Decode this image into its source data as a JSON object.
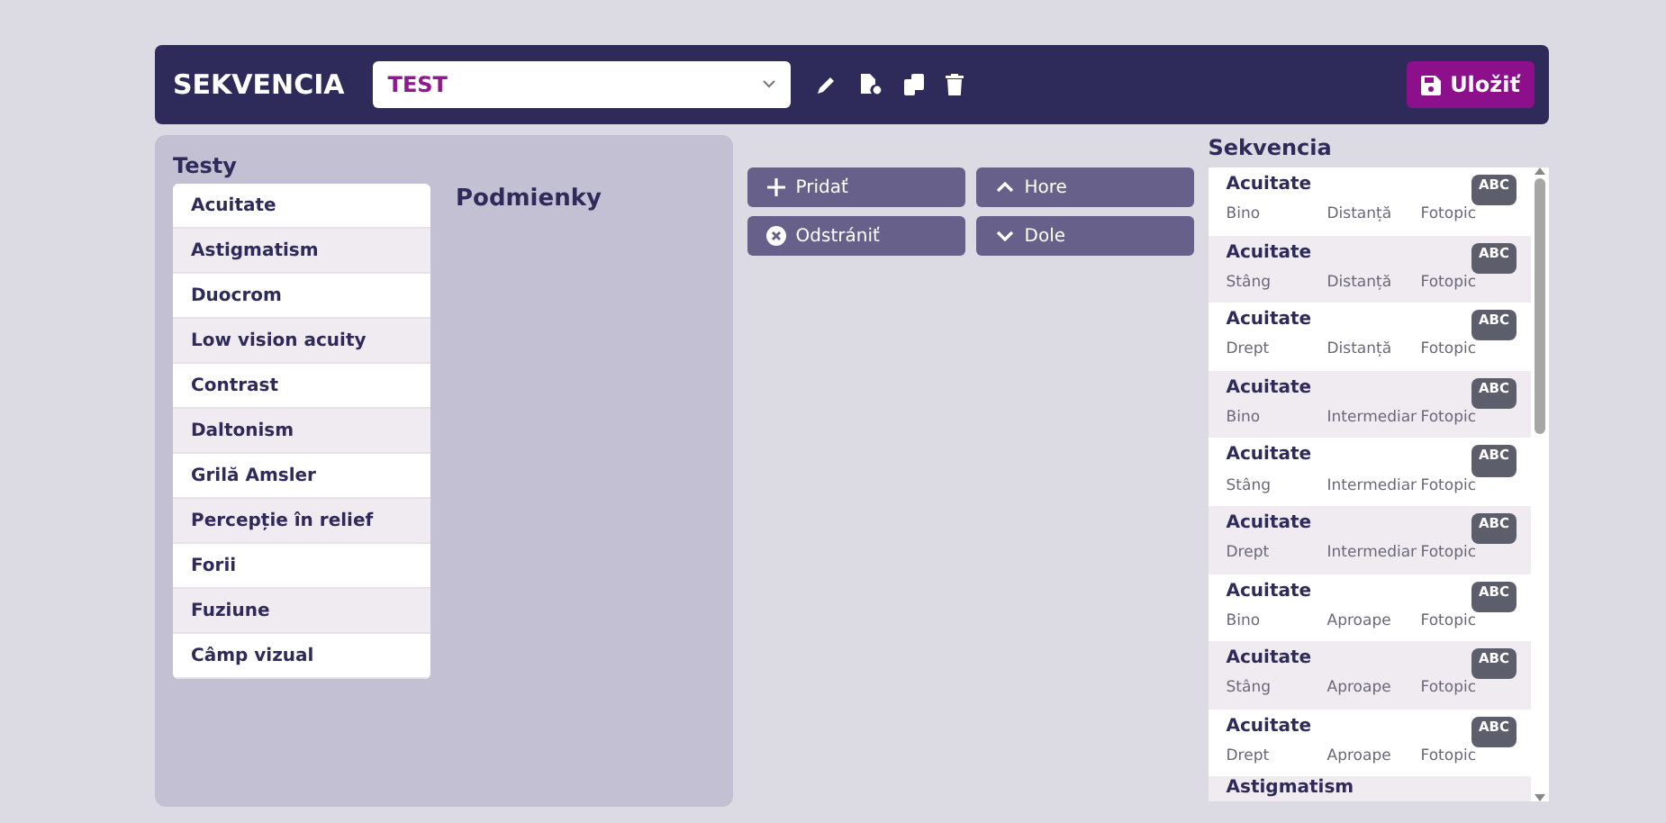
{
  "header": {
    "title": "SEKVENCIA",
    "sequence_select": {
      "value": "TEST"
    },
    "save_button": "Uložiť"
  },
  "tests": {
    "title": "Testy",
    "items": [
      "Acuitate",
      "Astigmatism",
      "Duocrom",
      "Low vision acuity",
      "Contrast",
      "Daltonism",
      "Grilă Amsler",
      "Percepție în relief",
      "Forii",
      "Fuziune",
      "Câmp vizual"
    ]
  },
  "conditions": {
    "title": "Podmienky"
  },
  "actions": [
    {
      "kind": "add",
      "label": "Pridať"
    },
    {
      "kind": "up",
      "label": "Hore"
    },
    {
      "kind": "remove",
      "label": "Odstrániť"
    },
    {
      "kind": "down",
      "label": "Dole"
    }
  ],
  "sequence": {
    "title": "Sekvencia",
    "items": [
      {
        "test": "Acuitate",
        "eye": "Bino",
        "distance": "Distanță",
        "light": "Fotopic",
        "badge": "ABC"
      },
      {
        "test": "Acuitate",
        "eye": "Stâng",
        "distance": "Distanță",
        "light": "Fotopic",
        "badge": "ABC"
      },
      {
        "test": "Acuitate",
        "eye": "Drept",
        "distance": "Distanță",
        "light": "Fotopic",
        "badge": "ABC"
      },
      {
        "test": "Acuitate",
        "eye": "Bino",
        "distance": "Intermediar",
        "light": "Fotopic",
        "badge": "ABC"
      },
      {
        "test": "Acuitate",
        "eye": "Stâng",
        "distance": "Intermediar",
        "light": "Fotopic",
        "badge": "ABC"
      },
      {
        "test": "Acuitate",
        "eye": "Drept",
        "distance": "Intermediar",
        "light": "Fotopic",
        "badge": "ABC"
      },
      {
        "test": "Acuitate",
        "eye": "Bino",
        "distance": "Aproape",
        "light": "Fotopic",
        "badge": "ABC"
      },
      {
        "test": "Acuitate",
        "eye": "Stâng",
        "distance": "Aproape",
        "light": "Fotopic",
        "badge": "ABC"
      },
      {
        "test": "Acuitate",
        "eye": "Drept",
        "distance": "Aproape",
        "light": "Fotopic",
        "badge": "ABC"
      },
      {
        "test": "Astigmatism"
      }
    ]
  }
}
